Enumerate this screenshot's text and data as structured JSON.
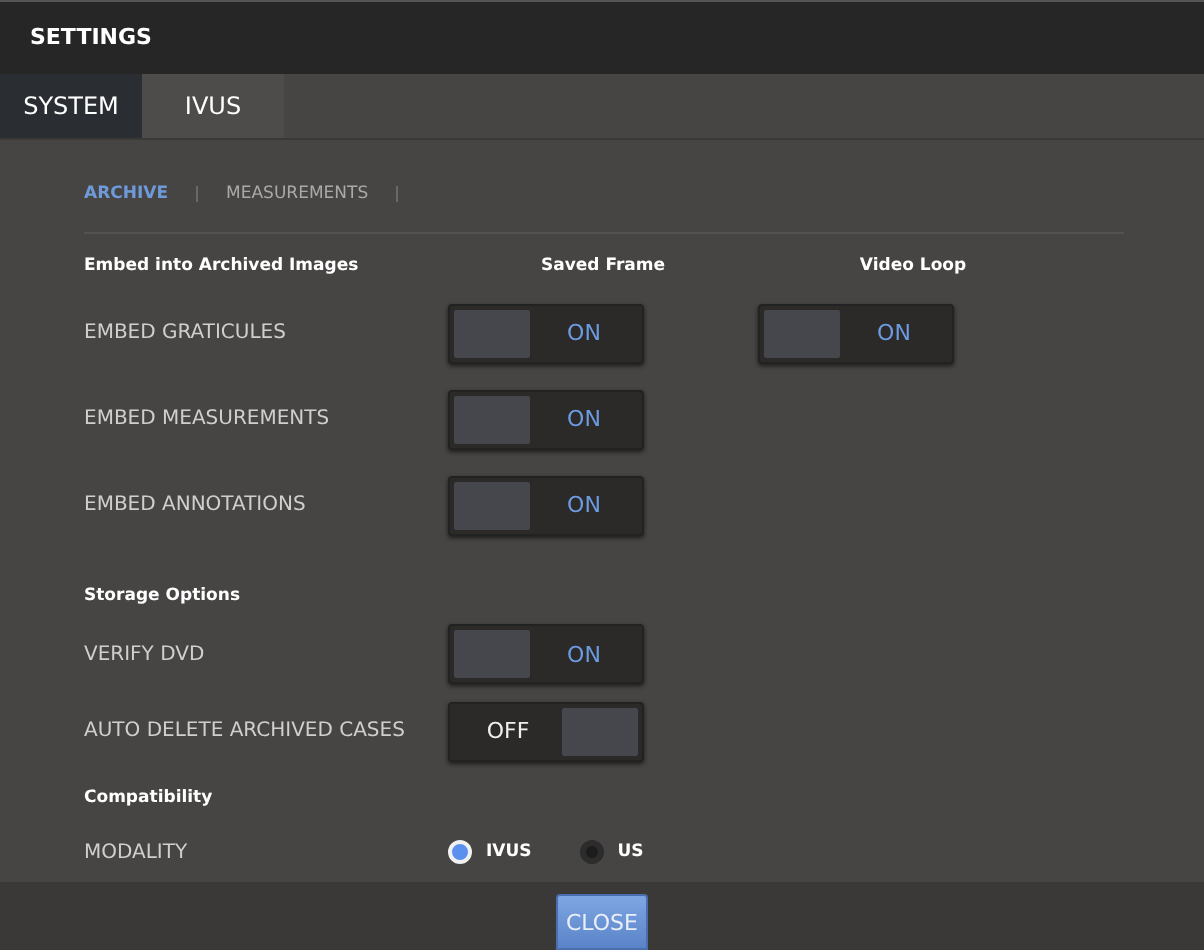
{
  "window": {
    "title": "SETTINGS"
  },
  "tabs": [
    {
      "label": "SYSTEM",
      "selected": true
    },
    {
      "label": "IVUS",
      "selected": false
    }
  ],
  "subtabs": [
    {
      "label": "ARCHIVE",
      "selected": true
    },
    {
      "label": "MEASUREMENTS",
      "selected": false
    }
  ],
  "sections": [
    {
      "heading": "Embed into Archived Images",
      "columns": [
        "Saved Frame",
        "Video Loop"
      ],
      "rows": [
        {
          "label": "EMBED GRATICULES",
          "kind": "toggles",
          "toggles": [
            {
              "on": true,
              "text": "ON"
            },
            {
              "on": true,
              "text": "ON"
            }
          ]
        },
        {
          "label": "EMBED MEASUREMENTS",
          "kind": "toggles",
          "toggles": [
            {
              "on": true,
              "text": "ON"
            }
          ]
        },
        {
          "label": "EMBED ANNOTATIONS",
          "kind": "toggles",
          "toggles": [
            {
              "on": true,
              "text": "ON"
            }
          ]
        }
      ]
    },
    {
      "heading": "Storage Options",
      "rows": [
        {
          "label": "VERIFY DVD",
          "kind": "toggles",
          "toggles": [
            {
              "on": true,
              "text": "ON"
            }
          ]
        },
        {
          "label": "AUTO DELETE ARCHIVED CASES",
          "kind": "toggles",
          "toggles": [
            {
              "on": false,
              "text": "OFF"
            }
          ]
        }
      ]
    },
    {
      "heading": "Compatibility",
      "rows": [
        {
          "label": "MODALITY",
          "kind": "radio",
          "options": [
            {
              "label": "IVUS",
              "selected": true
            },
            {
              "label": "US",
              "selected": false
            }
          ]
        }
      ]
    }
  ],
  "buttons": [
    "CLOSE"
  ]
}
